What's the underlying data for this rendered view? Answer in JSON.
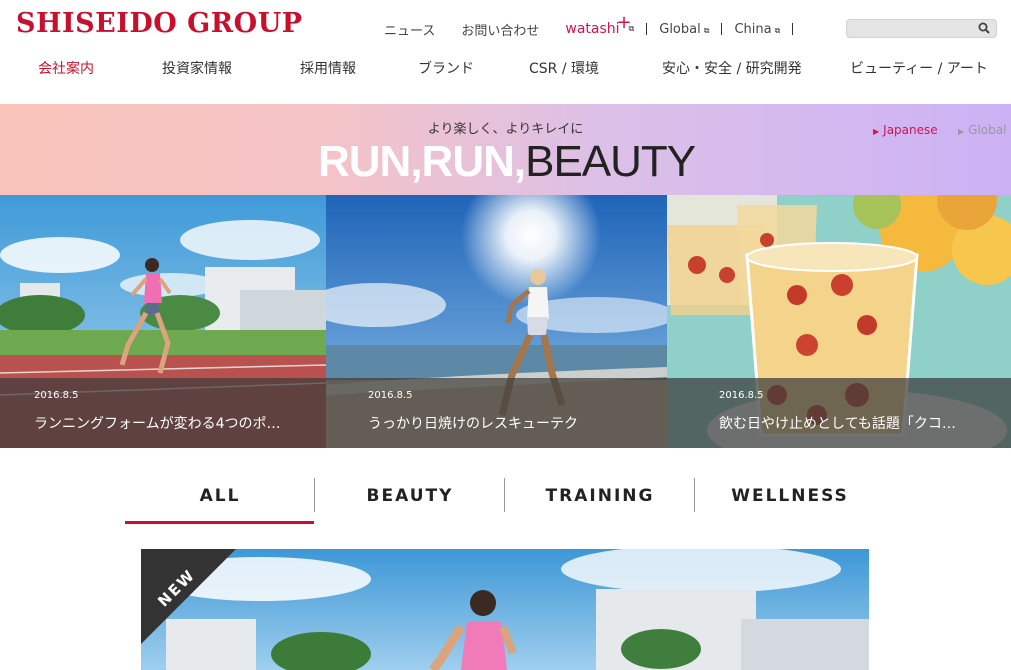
{
  "brand": {
    "logo_text": "SHISEIDO GROUP",
    "accent_color": "#c8102e",
    "pink_color": "#d3134f"
  },
  "utility_nav": {
    "news": "ニュース",
    "contact": "お問い合わせ",
    "watashi": "watashi",
    "global": "Global",
    "china": "China"
  },
  "search": {
    "placeholder": "",
    "icon": "search-icon"
  },
  "global_nav": [
    "会社案内",
    "投資家情報",
    "採用情報",
    "ブランド",
    "CSR / 環境",
    "安心・安全 / 研究開発",
    "ビューティー / アート"
  ],
  "hero": {
    "tagline": "より楽しく、よりキレイに",
    "title_part1": "RUN,RUN,",
    "title_part2": "BEAUTY",
    "lang_japanese": "Japanese",
    "lang_global": "Global"
  },
  "tiles": [
    {
      "date": "2016.8.5",
      "caption": "ランニングフォームが変わる4つのポ…"
    },
    {
      "date": "2016.8.5",
      "caption": "うっかり日焼けのレスキューテク"
    },
    {
      "date": "2016.8.5",
      "caption": "飲む日やけ止めとしても話題「クコ…"
    }
  ],
  "tabs": [
    "ALL",
    "BEAUTY",
    "TRAINING",
    "WELLNESS"
  ],
  "feature": {
    "badge": "NEW"
  }
}
